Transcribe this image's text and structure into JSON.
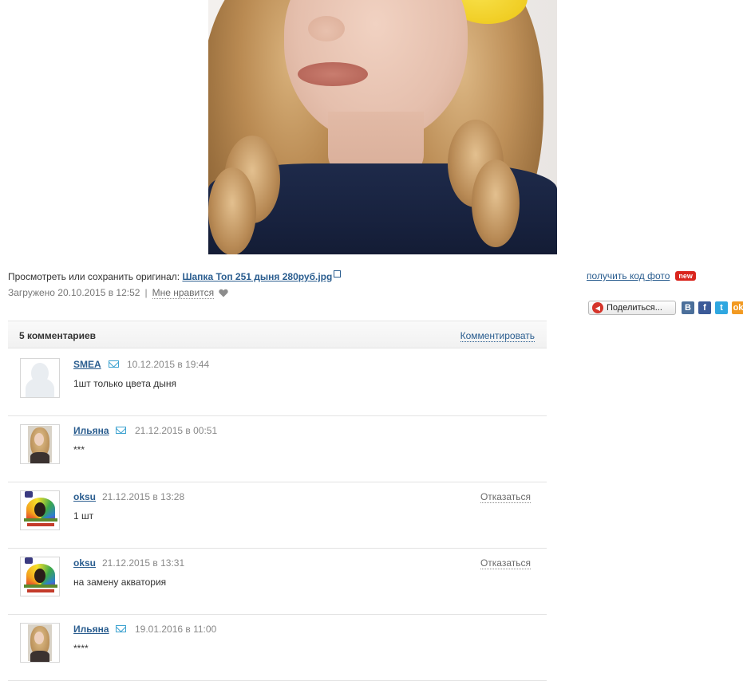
{
  "photo": {
    "subject": "photo-portrait"
  },
  "info": {
    "view_original_label": "Просмотреть или сохранить оригинал:",
    "file_name": "Шапка Топ 251 дыня 280руб.jpg",
    "uploaded": "Загружено 20.10.2015 в 12:52",
    "separator": "|",
    "like_label": "Мне нравится"
  },
  "sidebar": {
    "get_code_label": "получить код фото",
    "new_badge": "new",
    "share_label": "Поделиться...",
    "social": [
      "В",
      "f",
      "t",
      "ok"
    ]
  },
  "comments": {
    "count_label": "5 комментариев",
    "add_label": "Комментировать",
    "refuse_label": "Отказаться",
    "items": [
      {
        "author": "SMEA",
        "date": "10.12.2015 в 19:44",
        "text": "1шт только цвета дыня"
      },
      {
        "author": "Ильяна",
        "date": "21.12.2015 в 00:51",
        "text": "***"
      },
      {
        "author": "oksu",
        "date": "21.12.2015 в 13:28",
        "text": "1 шт"
      },
      {
        "author": "oksu",
        "date": "21.12.2015 в 13:31",
        "text": "на замену акватория"
      },
      {
        "author": "Ильяна",
        "date": "19.01.2016 в 11:00",
        "text": "****"
      }
    ]
  },
  "colors": {
    "link": "#2a5d8f",
    "badge": "#d9251d",
    "muted": "#888888"
  }
}
